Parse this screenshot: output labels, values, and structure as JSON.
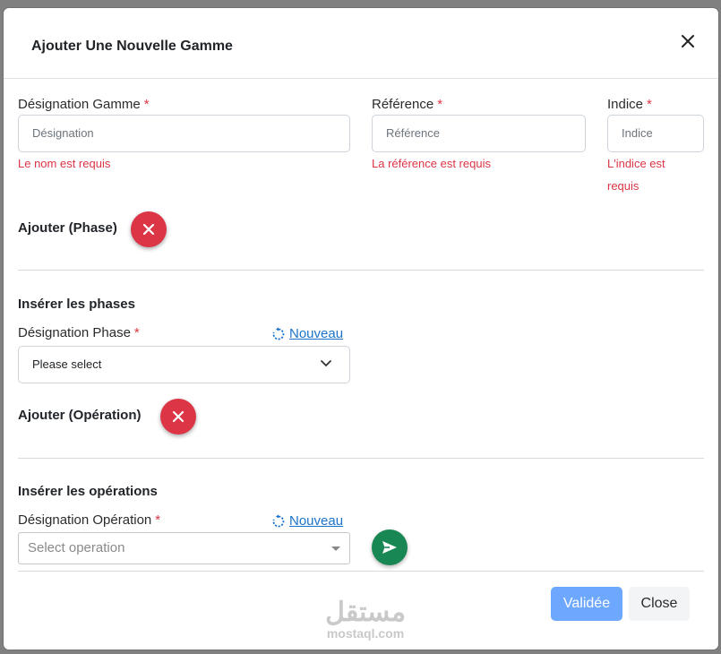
{
  "modal": {
    "title": "Ajouter Une Nouvelle Gamme",
    "close_icon": "close-icon"
  },
  "fields": {
    "designation": {
      "label": "Désignation Gamme",
      "required_mark": "*",
      "placeholder": "Désignation",
      "error": "Le nom est requis"
    },
    "reference": {
      "label": "Référence",
      "required_mark": "*",
      "placeholder": "Référence",
      "error": "La référence est requis"
    },
    "indice": {
      "label": "Indice",
      "required_mark": "*",
      "placeholder": "Indice",
      "error_line1": "L'indice est",
      "error_line2": "requis"
    }
  },
  "phase_section": {
    "add_label": "Ajouter (Phase)",
    "insert_title": "Insérer les phases",
    "field_label": "Désignation Phase",
    "required_mark": "*",
    "nouveau_label": "Nouveau",
    "select_value": "Please select"
  },
  "operation_section": {
    "add_label": "Ajouter (Opération)",
    "insert_title": "Insérer les opérations",
    "field_label": "Désignation Opération",
    "required_mark": "*",
    "nouveau_label": "Nouveau",
    "select_placeholder": "Select operation"
  },
  "footer": {
    "validate_label": "Validée",
    "close_label": "Close"
  },
  "watermark": {
    "arabic": "مستقل",
    "latin": "mostaql.com"
  },
  "colors": {
    "danger": "#dc3545",
    "success": "#198754",
    "primary_light": "#6ea8fe",
    "link": "#1a73c9"
  }
}
